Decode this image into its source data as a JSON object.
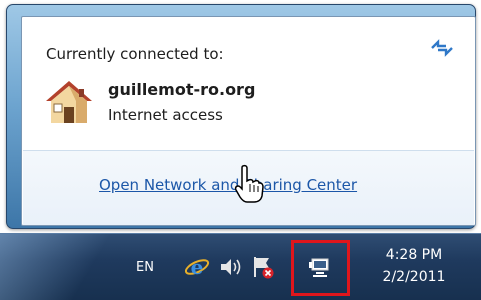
{
  "flyout": {
    "title": "Currently connected to:",
    "network_name": "guillemot-ro.org",
    "network_status": "Internet access",
    "link_label": "Open Network and Sharing Center",
    "icons": {
      "refresh": "refresh-icon",
      "network": "house-icon"
    }
  },
  "taskbar": {
    "language": "EN",
    "clock_time": "4:28 PM",
    "clock_date": "2/2/2011",
    "tray_icons": [
      "ie-icon",
      "speaker-icon",
      "action-center-flag-icon",
      "network-icon"
    ],
    "highlight_color": "#e0161c"
  },
  "colors": {
    "link": "#1c57a8",
    "taskbar": "#1f3a5e"
  }
}
